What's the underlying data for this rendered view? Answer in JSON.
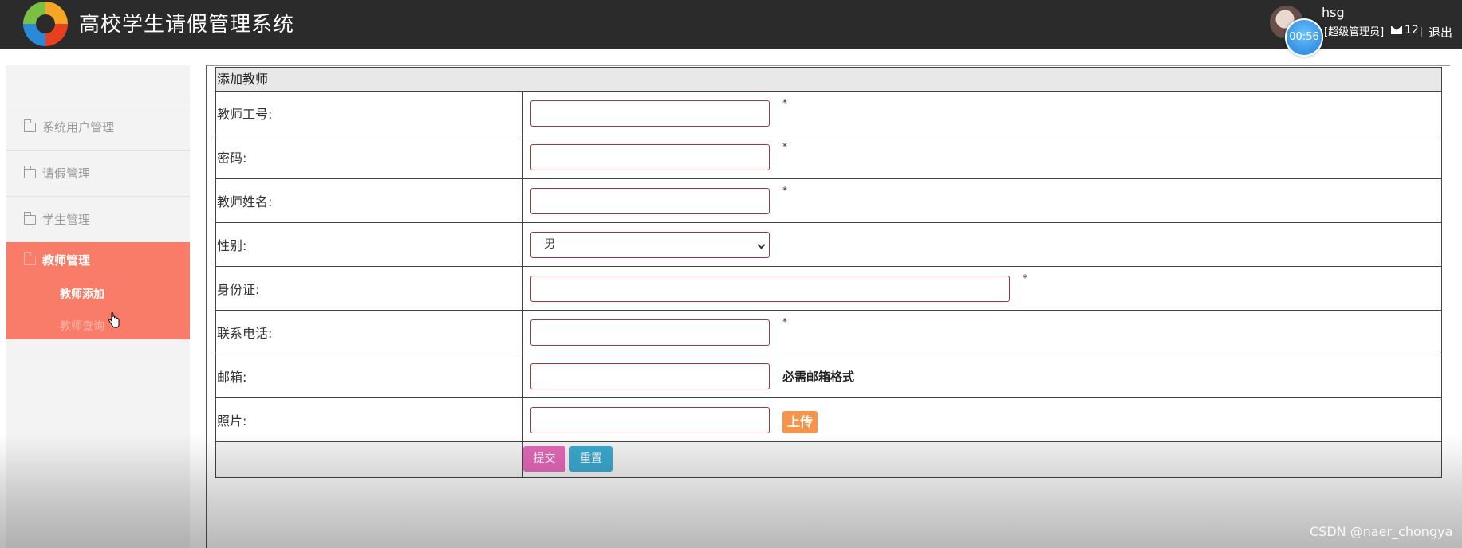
{
  "header": {
    "app_title": "高校学生请假管理系统",
    "username": "hsg",
    "role": "[超级管理员]",
    "timer": "00:56",
    "message_count": "12",
    "logout_label": "退出"
  },
  "sidebar": {
    "items": [
      {
        "label": "系统用户管理"
      },
      {
        "label": "请假管理"
      },
      {
        "label": "学生管理"
      }
    ],
    "active_group": {
      "label": "教师管理",
      "sub_items": [
        {
          "label": "教师添加"
        },
        {
          "label": "教师查询"
        }
      ]
    }
  },
  "form": {
    "title": "添加教师",
    "fields": [
      {
        "label": "教师工号:",
        "value": "",
        "required_mark": "*"
      },
      {
        "label": "密码:",
        "value": "",
        "required_mark": "*"
      },
      {
        "label": "教师姓名:",
        "value": "",
        "required_mark": "*"
      },
      {
        "label": "性别:",
        "selected": "男"
      },
      {
        "label": "身份证:",
        "value": "",
        "required_mark": "*"
      },
      {
        "label": "联系电话:",
        "value": "",
        "required_mark": "*"
      },
      {
        "label": "邮箱:",
        "value": "",
        "hint": "必需邮箱格式"
      },
      {
        "label": "照片:",
        "value": "",
        "upload_label": "上传"
      }
    ],
    "submit_label": "提交",
    "reset_label": "重置"
  },
  "watermark": "CSDN @naer_chongya",
  "colors": {
    "topbar": "#2b2b2b",
    "sidebar_active": "#f87c68",
    "submit_button": "#e268b7",
    "reset_button": "#3aa8cf",
    "upload_button": "#f7944a"
  }
}
